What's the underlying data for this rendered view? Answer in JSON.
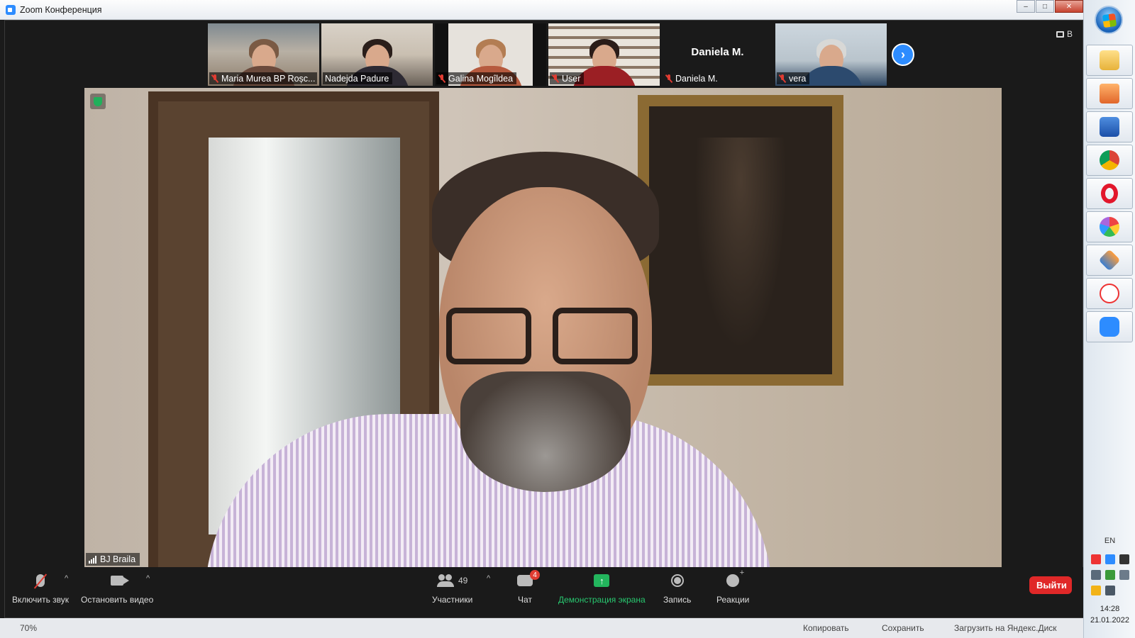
{
  "window": {
    "title": "Zoom Конференция",
    "controls": {
      "minimize": "–",
      "maximize": "□",
      "close": "✕"
    }
  },
  "view_button": {
    "label": "В"
  },
  "participants_strip": [
    {
      "name": "Maria Murea BP Roșc...",
      "muted": true,
      "video": true
    },
    {
      "name": "Nadejda Padure",
      "muted": false,
      "video": true
    },
    {
      "name": "Galina Mogîldea",
      "muted": true,
      "video": true
    },
    {
      "name": "User",
      "muted": true,
      "video": true
    },
    {
      "name": "Daniela M.",
      "muted": true,
      "video": false,
      "display_name": "Daniela M."
    },
    {
      "name": "vera",
      "muted": true,
      "video": true
    }
  ],
  "next_page_icon": "chevron-right-icon",
  "active_speaker": {
    "name": "BJ Braila"
  },
  "toolbar": {
    "unmute_label": "Включить звук",
    "stop_video_label": "Остановить видео",
    "participants_label": "Участники",
    "participants_count": "49",
    "chat_label": "Чат",
    "chat_badge": "4",
    "share_label": "Демонстрация экрана",
    "record_label": "Запись",
    "reactions_label": "Реакции",
    "leave_label": "Выйти",
    "share_color": "#23b55d",
    "leave_color": "#e02828"
  },
  "taskbar": {
    "apps": [
      "file-explorer-icon",
      "media-player-icon",
      "word-icon",
      "chrome-icon",
      "opera-icon",
      "paint-icon",
      "viewer-icon",
      "yandex-icon",
      "zoom-icon"
    ],
    "language": "EN",
    "time": "14:28",
    "date": "21.01.2022"
  },
  "background_strip": {
    "zoom_percent": "70%",
    "copy": "Копировать",
    "save": "Сохранить",
    "upload": "Загрузить на Яндекс.Диск"
  }
}
